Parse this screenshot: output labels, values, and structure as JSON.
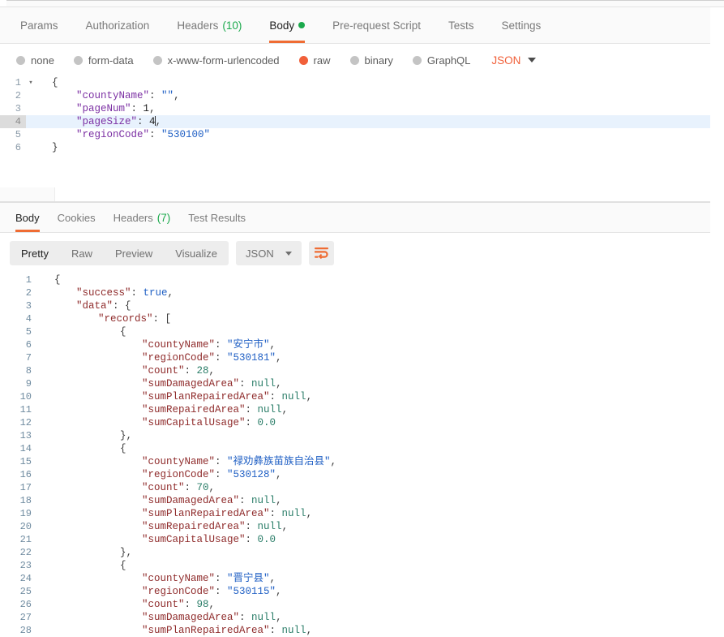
{
  "request": {
    "tabs": [
      {
        "label": "Params",
        "active": false,
        "count": null,
        "dot": false
      },
      {
        "label": "Authorization",
        "active": false,
        "count": null,
        "dot": false
      },
      {
        "label": "Headers",
        "active": false,
        "count": "(10)",
        "dot": false
      },
      {
        "label": "Body",
        "active": true,
        "count": null,
        "dot": true
      },
      {
        "label": "Pre-request Script",
        "active": false,
        "count": null,
        "dot": false
      },
      {
        "label": "Tests",
        "active": false,
        "count": null,
        "dot": false
      },
      {
        "label": "Settings",
        "active": false,
        "count": null,
        "dot": false
      }
    ],
    "body_types": [
      {
        "label": "none",
        "selected": false
      },
      {
        "label": "form-data",
        "selected": false
      },
      {
        "label": "x-www-form-urlencoded",
        "selected": false
      },
      {
        "label": "raw",
        "selected": true
      },
      {
        "label": "binary",
        "selected": false
      },
      {
        "label": "GraphQL",
        "selected": false
      }
    ],
    "format_label": "JSON",
    "editor": {
      "lines": [
        {
          "num": "1",
          "fold": "▾",
          "active": false,
          "tokens": [
            {
              "t": "{",
              "c": "p-req"
            }
          ]
        },
        {
          "num": "2",
          "fold": "",
          "active": false,
          "tokens": [
            {
              "t": "    ",
              "c": "p-req"
            },
            {
              "t": "\"countyName\"",
              "c": "k-req"
            },
            {
              "t": ": ",
              "c": "p-req"
            },
            {
              "t": "\"\"",
              "c": "s-req"
            },
            {
              "t": ",",
              "c": "p-req"
            }
          ]
        },
        {
          "num": "3",
          "fold": "",
          "active": false,
          "tokens": [
            {
              "t": "    ",
              "c": "p-req"
            },
            {
              "t": "\"pageNum\"",
              "c": "k-req"
            },
            {
              "t": ": ",
              "c": "p-req"
            },
            {
              "t": "1",
              "c": "n-req"
            },
            {
              "t": ",",
              "c": "p-req"
            }
          ]
        },
        {
          "num": "4",
          "fold": "",
          "active": true,
          "tokens": [
            {
              "t": "    ",
              "c": "p-req"
            },
            {
              "t": "\"pageSize\"",
              "c": "k-req"
            },
            {
              "t": ": ",
              "c": "p-req"
            },
            {
              "t": "4",
              "c": "n-req"
            },
            {
              "t": "|CARET|",
              "c": "caret"
            },
            {
              "t": ",",
              "c": "p-req"
            }
          ]
        },
        {
          "num": "5",
          "fold": "",
          "active": false,
          "tokens": [
            {
              "t": "    ",
              "c": "p-req"
            },
            {
              "t": "\"regionCode\"",
              "c": "k-req"
            },
            {
              "t": ": ",
              "c": "p-req"
            },
            {
              "t": "\"530100\"",
              "c": "s-req"
            }
          ]
        },
        {
          "num": "6",
          "fold": "",
          "active": false,
          "tokens": [
            {
              "t": "}",
              "c": "p-req"
            }
          ]
        }
      ]
    }
  },
  "response": {
    "tabs": [
      {
        "label": "Body",
        "active": true,
        "count": null
      },
      {
        "label": "Cookies",
        "active": false,
        "count": null
      },
      {
        "label": "Headers",
        "active": false,
        "count": "(7)"
      },
      {
        "label": "Test Results",
        "active": false,
        "count": null
      }
    ],
    "view_modes": [
      {
        "label": "Pretty",
        "active": true
      },
      {
        "label": "Raw",
        "active": false
      },
      {
        "label": "Preview",
        "active": false
      },
      {
        "label": "Visualize",
        "active": false
      }
    ],
    "format_label": "JSON",
    "wrap_icon": "word-wrap-icon",
    "body": {
      "lines": [
        {
          "num": "1",
          "indent": 0,
          "tokens": [
            {
              "t": "{",
              "c": "p-res"
            }
          ]
        },
        {
          "num": "2",
          "indent": 1,
          "tokens": [
            {
              "t": "\"success\"",
              "c": "k-res"
            },
            {
              "t": ": ",
              "c": "p-res"
            },
            {
              "t": "true",
              "c": "b-res"
            },
            {
              "t": ",",
              "c": "p-res"
            }
          ]
        },
        {
          "num": "3",
          "indent": 1,
          "tokens": [
            {
              "t": "\"data\"",
              "c": "k-res"
            },
            {
              "t": ": {",
              "c": "p-res"
            }
          ]
        },
        {
          "num": "4",
          "indent": 2,
          "tokens": [
            {
              "t": "\"records\"",
              "c": "k-res"
            },
            {
              "t": ": [",
              "c": "p-res"
            }
          ]
        },
        {
          "num": "5",
          "indent": 3,
          "tokens": [
            {
              "t": "{",
              "c": "p-res"
            }
          ]
        },
        {
          "num": "6",
          "indent": 4,
          "tokens": [
            {
              "t": "\"countyName\"",
              "c": "k-res"
            },
            {
              "t": ": ",
              "c": "p-res"
            },
            {
              "t": "\"安宁市\"",
              "c": "s-res"
            },
            {
              "t": ",",
              "c": "p-res"
            }
          ]
        },
        {
          "num": "7",
          "indent": 4,
          "tokens": [
            {
              "t": "\"regionCode\"",
              "c": "k-res"
            },
            {
              "t": ": ",
              "c": "p-res"
            },
            {
              "t": "\"530181\"",
              "c": "s-res"
            },
            {
              "t": ",",
              "c": "p-res"
            }
          ]
        },
        {
          "num": "8",
          "indent": 4,
          "tokens": [
            {
              "t": "\"count\"",
              "c": "k-res"
            },
            {
              "t": ": ",
              "c": "p-res"
            },
            {
              "t": "28",
              "c": "n-res"
            },
            {
              "t": ",",
              "c": "p-res"
            }
          ]
        },
        {
          "num": "9",
          "indent": 4,
          "tokens": [
            {
              "t": "\"sumDamagedArea\"",
              "c": "k-res"
            },
            {
              "t": ": ",
              "c": "p-res"
            },
            {
              "t": "null",
              "c": "null-res"
            },
            {
              "t": ",",
              "c": "p-res"
            }
          ]
        },
        {
          "num": "10",
          "indent": 4,
          "tokens": [
            {
              "t": "\"sumPlanRepairedArea\"",
              "c": "k-res"
            },
            {
              "t": ": ",
              "c": "p-res"
            },
            {
              "t": "null",
              "c": "null-res"
            },
            {
              "t": ",",
              "c": "p-res"
            }
          ]
        },
        {
          "num": "11",
          "indent": 4,
          "tokens": [
            {
              "t": "\"sumRepairedArea\"",
              "c": "k-res"
            },
            {
              "t": ": ",
              "c": "p-res"
            },
            {
              "t": "null",
              "c": "null-res"
            },
            {
              "t": ",",
              "c": "p-res"
            }
          ]
        },
        {
          "num": "12",
          "indent": 4,
          "tokens": [
            {
              "t": "\"sumCapitalUsage\"",
              "c": "k-res"
            },
            {
              "t": ": ",
              "c": "p-res"
            },
            {
              "t": "0.0",
              "c": "n-res"
            }
          ]
        },
        {
          "num": "13",
          "indent": 3,
          "tokens": [
            {
              "t": "},",
              "c": "p-res"
            }
          ]
        },
        {
          "num": "14",
          "indent": 3,
          "tokens": [
            {
              "t": "{",
              "c": "p-res"
            }
          ]
        },
        {
          "num": "15",
          "indent": 4,
          "tokens": [
            {
              "t": "\"countyName\"",
              "c": "k-res"
            },
            {
              "t": ": ",
              "c": "p-res"
            },
            {
              "t": "\"禄劝彝族苗族自治县\"",
              "c": "s-res"
            },
            {
              "t": ",",
              "c": "p-res"
            }
          ]
        },
        {
          "num": "16",
          "indent": 4,
          "tokens": [
            {
              "t": "\"regionCode\"",
              "c": "k-res"
            },
            {
              "t": ": ",
              "c": "p-res"
            },
            {
              "t": "\"530128\"",
              "c": "s-res"
            },
            {
              "t": ",",
              "c": "p-res"
            }
          ]
        },
        {
          "num": "17",
          "indent": 4,
          "tokens": [
            {
              "t": "\"count\"",
              "c": "k-res"
            },
            {
              "t": ": ",
              "c": "p-res"
            },
            {
              "t": "70",
              "c": "n-res"
            },
            {
              "t": ",",
              "c": "p-res"
            }
          ]
        },
        {
          "num": "18",
          "indent": 4,
          "tokens": [
            {
              "t": "\"sumDamagedArea\"",
              "c": "k-res"
            },
            {
              "t": ": ",
              "c": "p-res"
            },
            {
              "t": "null",
              "c": "null-res"
            },
            {
              "t": ",",
              "c": "p-res"
            }
          ]
        },
        {
          "num": "19",
          "indent": 4,
          "tokens": [
            {
              "t": "\"sumPlanRepairedArea\"",
              "c": "k-res"
            },
            {
              "t": ": ",
              "c": "p-res"
            },
            {
              "t": "null",
              "c": "null-res"
            },
            {
              "t": ",",
              "c": "p-res"
            }
          ]
        },
        {
          "num": "20",
          "indent": 4,
          "tokens": [
            {
              "t": "\"sumRepairedArea\"",
              "c": "k-res"
            },
            {
              "t": ": ",
              "c": "p-res"
            },
            {
              "t": "null",
              "c": "null-res"
            },
            {
              "t": ",",
              "c": "p-res"
            }
          ]
        },
        {
          "num": "21",
          "indent": 4,
          "tokens": [
            {
              "t": "\"sumCapitalUsage\"",
              "c": "k-res"
            },
            {
              "t": ": ",
              "c": "p-res"
            },
            {
              "t": "0.0",
              "c": "n-res"
            }
          ]
        },
        {
          "num": "22",
          "indent": 3,
          "tokens": [
            {
              "t": "},",
              "c": "p-res"
            }
          ]
        },
        {
          "num": "23",
          "indent": 3,
          "tokens": [
            {
              "t": "{",
              "c": "p-res"
            }
          ]
        },
        {
          "num": "24",
          "indent": 4,
          "tokens": [
            {
              "t": "\"countyName\"",
              "c": "k-res"
            },
            {
              "t": ": ",
              "c": "p-res"
            },
            {
              "t": "\"晋宁县\"",
              "c": "s-res"
            },
            {
              "t": ",",
              "c": "p-res"
            }
          ]
        },
        {
          "num": "25",
          "indent": 4,
          "tokens": [
            {
              "t": "\"regionCode\"",
              "c": "k-res"
            },
            {
              "t": ": ",
              "c": "p-res"
            },
            {
              "t": "\"530115\"",
              "c": "s-res"
            },
            {
              "t": ",",
              "c": "p-res"
            }
          ]
        },
        {
          "num": "26",
          "indent": 4,
          "tokens": [
            {
              "t": "\"count\"",
              "c": "k-res"
            },
            {
              "t": ": ",
              "c": "p-res"
            },
            {
              "t": "98",
              "c": "n-res"
            },
            {
              "t": ",",
              "c": "p-res"
            }
          ]
        },
        {
          "num": "27",
          "indent": 4,
          "tokens": [
            {
              "t": "\"sumDamagedArea\"",
              "c": "k-res"
            },
            {
              "t": ": ",
              "c": "p-res"
            },
            {
              "t": "null",
              "c": "null-res"
            },
            {
              "t": ",",
              "c": "p-res"
            }
          ]
        },
        {
          "num": "28",
          "indent": 4,
          "tokens": [
            {
              "t": "\"sumPlanRepairedArea\"",
              "c": "k-res"
            },
            {
              "t": ": ",
              "c": "p-res"
            },
            {
              "t": "null",
              "c": "null-res"
            },
            {
              "t": ",",
              "c": "p-res"
            }
          ]
        }
      ]
    }
  },
  "colors": {
    "accent": "#ef6c33",
    "green": "#1ba94c",
    "active_line": "#e8f2fd",
    "toolbar_bg": "#ededed"
  }
}
